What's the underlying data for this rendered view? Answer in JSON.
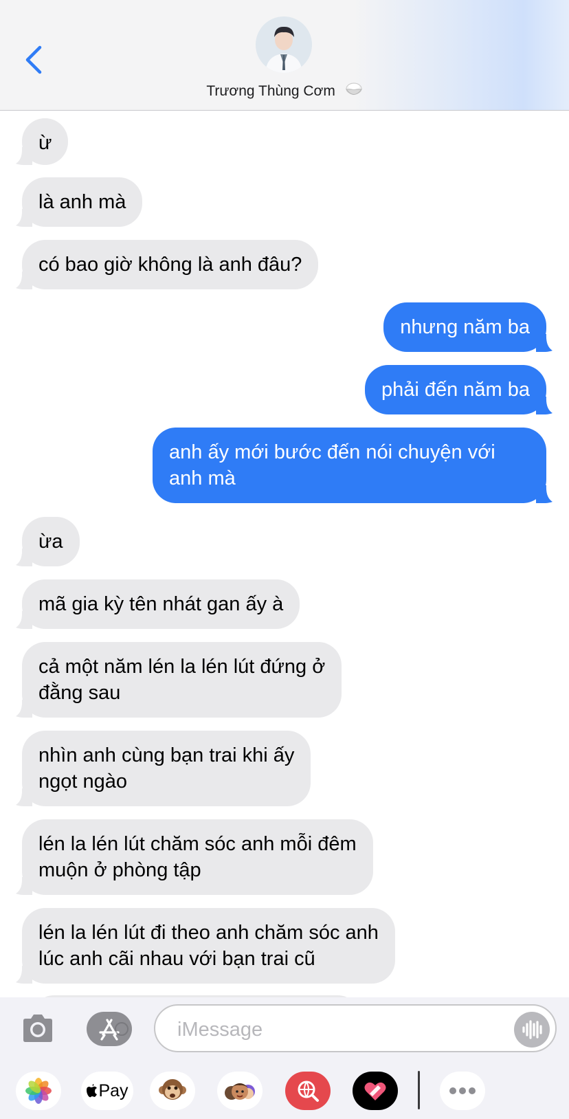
{
  "header": {
    "contact_name": "Trương Thùng Cơm"
  },
  "messages": [
    {
      "side": "recv",
      "text": "ừ"
    },
    {
      "side": "recv",
      "text": "là anh mà"
    },
    {
      "side": "recv",
      "text": "có bao giờ không là anh đâu?"
    },
    {
      "side": "sent",
      "text": "nhưng năm ba"
    },
    {
      "side": "sent",
      "text": "phải đến năm ba"
    },
    {
      "side": "sent",
      "lines": [
        "anh ấy mới bước đến nói chuyện với",
        "anh mà"
      ]
    },
    {
      "side": "recv",
      "text": "ừa"
    },
    {
      "side": "recv",
      "text": "mã gia kỳ tên nhát gan ấy à"
    },
    {
      "side": "recv",
      "lines": [
        "cả một năm lén la lén lút đứng ở",
        "đằng sau"
      ]
    },
    {
      "side": "recv",
      "lines": [
        "nhìn anh cùng bạn trai khi ấy",
        "ngọt ngào"
      ]
    },
    {
      "side": "recv",
      "lines": [
        "lén la lén lút chăm sóc anh mỗi đêm",
        "muộn ở phòng tập"
      ]
    },
    {
      "side": "recv",
      "lines": [
        "lén la lén lút đi theo anh chăm sóc anh",
        "lúc anh cãi nhau với bạn trai cũ"
      ]
    }
  ],
  "input": {
    "placeholder": "iMessage"
  },
  "app_drawer": {
    "apple_pay_label": "Pay"
  },
  "colors": {
    "sent_bubble": "#2f7cf6",
    "received_bubble": "#e9e9eb",
    "accent": "#2f7cf6"
  },
  "icons": [
    "chevron-left-icon",
    "avatar",
    "rice-bowl-emoji",
    "camera-icon",
    "app-store-icon",
    "audio-waveform-icon",
    "photos-app-icon",
    "apple-pay-icon",
    "animoji-monkey-icon",
    "memoji-icon",
    "search-images-icon",
    "digital-touch-heart-icon",
    "more-apps-icon"
  ]
}
